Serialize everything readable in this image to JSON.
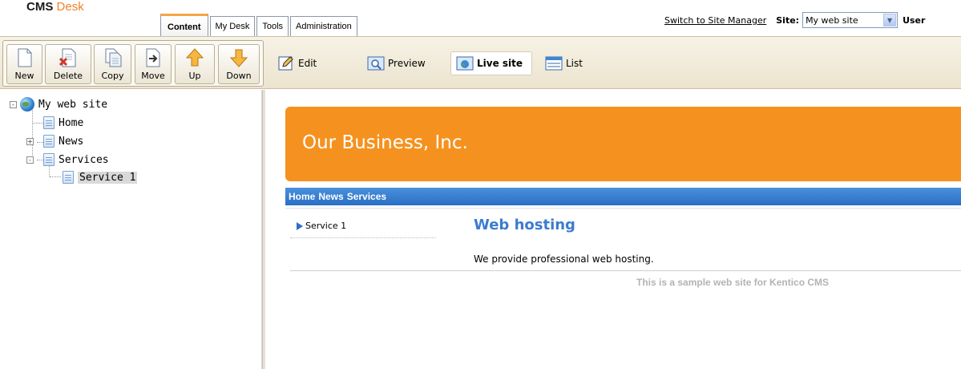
{
  "header": {
    "logo_cms": "CMS",
    "logo_desk": "Desk",
    "tabs": [
      {
        "label": "Content",
        "active": true
      },
      {
        "label": "My Desk",
        "active": false
      },
      {
        "label": "Tools",
        "active": false
      },
      {
        "label": "Administration",
        "active": false
      }
    ],
    "switch_link": "Switch to Site Manager",
    "site_label": "Site:",
    "site_value": "My web site",
    "user_label": "User"
  },
  "toolbar": {
    "buttons": [
      {
        "label": "New",
        "icon": "new-document-icon"
      },
      {
        "label": "Delete",
        "icon": "delete-document-icon"
      },
      {
        "label": "Copy",
        "icon": "copy-document-icon"
      },
      {
        "label": "Move",
        "icon": "move-document-icon"
      },
      {
        "label": "Up",
        "icon": "arrow-up-icon"
      },
      {
        "label": "Down",
        "icon": "arrow-down-icon"
      }
    ],
    "views": [
      {
        "label": "Edit",
        "icon": "edit-icon",
        "active": false
      },
      {
        "label": "Preview",
        "icon": "preview-icon",
        "active": false
      },
      {
        "label": "Live site",
        "icon": "live-site-icon",
        "active": true
      },
      {
        "label": "List",
        "icon": "list-icon",
        "active": false
      }
    ]
  },
  "tree": {
    "root": "My web site",
    "nodes": [
      {
        "label": "Home",
        "expander": ""
      },
      {
        "label": "News",
        "expander": "+"
      },
      {
        "label": "Services",
        "expander": "-"
      },
      {
        "label": "Service 1",
        "expander": "",
        "selected": true
      }
    ],
    "root_expander": "-"
  },
  "site": {
    "banner_title": "Our Business, Inc.",
    "menu": [
      "Home",
      "News",
      "Services"
    ],
    "submenu": [
      "Service 1"
    ],
    "heading": "Web hosting",
    "body_text": "We provide professional web hosting.",
    "footer": "This is a sample web site for Kentico CMS"
  },
  "colors": {
    "banner": "#f5921f",
    "menubar": "#2a6fc4",
    "heading": "#3b7bd0",
    "logo_accent": "#f0812a"
  }
}
